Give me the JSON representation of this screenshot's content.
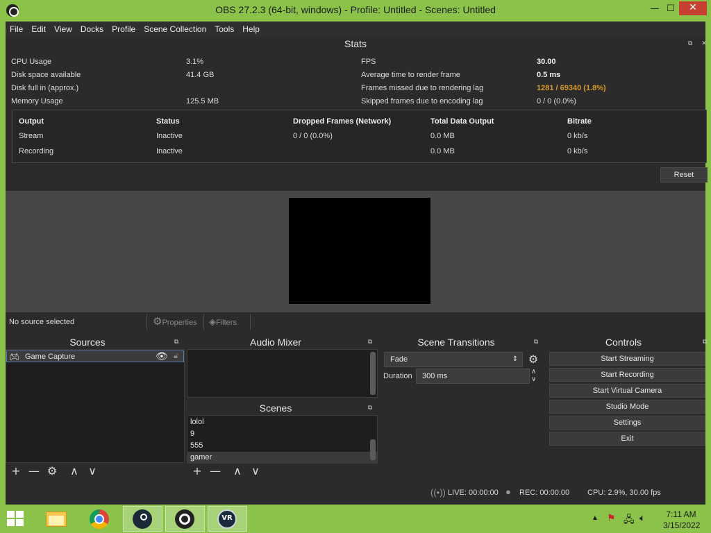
{
  "window": {
    "title": "OBS 27.2.3 (64-bit, windows) - Profile: Untitled - Scenes: Untitled",
    "controls": {
      "minimize": "—",
      "maximize": "☐",
      "close": "✕"
    }
  },
  "menu": [
    "File",
    "Edit",
    "View",
    "Docks",
    "Profile",
    "Scene Collection",
    "Tools",
    "Help"
  ],
  "stats": {
    "title": "Stats",
    "left": [
      {
        "label": "CPU Usage",
        "value": "3.1%"
      },
      {
        "label": "Disk space available",
        "value": "41.4 GB"
      },
      {
        "label": "Disk full in (approx.)",
        "value": ""
      },
      {
        "label": "Memory Usage",
        "value": "125.5 MB"
      }
    ],
    "right": [
      {
        "label": "FPS",
        "value": "30.00"
      },
      {
        "label": "Average time to render frame",
        "value": "0.5 ms"
      },
      {
        "label": "Frames missed due to rendering lag",
        "value": "1281 / 69340 (1.8%)"
      },
      {
        "label": "Skipped frames due to encoding lag",
        "value": "0 / 0 (0.0%)"
      }
    ],
    "output_table": {
      "headers": [
        "Output",
        "Status",
        "Dropped Frames (Network)",
        "Total Data Output",
        "Bitrate"
      ],
      "rows": [
        [
          "Stream",
          "Inactive",
          "0 / 0 (0.0%)",
          "0.0 MB",
          "0 kb/s"
        ],
        [
          "Recording",
          "Inactive",
          "",
          "0.0 MB",
          "0 kb/s"
        ]
      ]
    },
    "reset_label": "Reset"
  },
  "source_toolbar": {
    "no_source": "No source selected",
    "properties": "Properties",
    "filters": "Filters"
  },
  "sources": {
    "title": "Sources",
    "items": [
      "Game Capture"
    ]
  },
  "audio_mixer": {
    "title": "Audio Mixer"
  },
  "scenes": {
    "title": "Scenes",
    "items": [
      "lolol",
      "9",
      "555",
      "gamer"
    ]
  },
  "transitions": {
    "title": "Scene Transitions",
    "selected": "Fade",
    "duration_label": "Duration",
    "duration_value": "300 ms"
  },
  "controls": {
    "title": "Controls",
    "buttons": [
      "Start Streaming",
      "Start Recording",
      "Start Virtual Camera",
      "Studio Mode",
      "Settings",
      "Exit"
    ]
  },
  "status": {
    "live": "LIVE: 00:00:00",
    "rec": "REC: 00:00:00",
    "cpu": "CPU: 2.9%, 30.00 fps"
  },
  "taskbar": {
    "apps": [
      "file-explorer",
      "chrome",
      "steam",
      "obs",
      "vr"
    ],
    "vr_label": "VR",
    "time": "7:11 AM",
    "date": "3/15/2022"
  },
  "colors": {
    "frame": "#8bc34a",
    "warn": "#d99a2b",
    "close": "#c84031"
  }
}
